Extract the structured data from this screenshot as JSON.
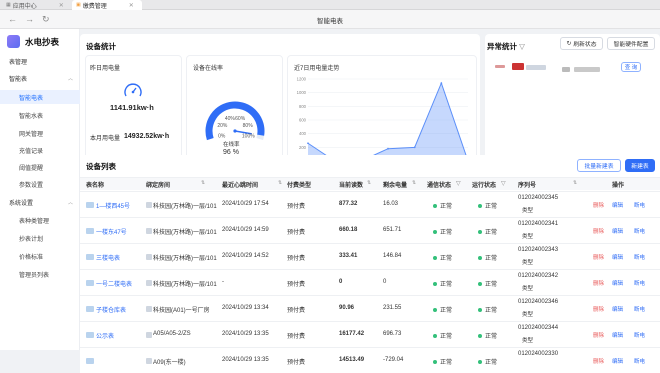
{
  "tabs": [
    {
      "label": "应用中心"
    },
    {
      "label": "缴费管理"
    }
  ],
  "window_title": "智能电表",
  "brand": "水电抄表",
  "sidebar": {
    "items": [
      {
        "label": "表管理",
        "type": "group"
      },
      {
        "label": "智能表",
        "type": "group",
        "active_group": true
      },
      {
        "label": "智能电表",
        "type": "sub",
        "active": true
      },
      {
        "label": "智能水表",
        "type": "sub"
      },
      {
        "label": "网关管理",
        "type": "sub"
      },
      {
        "label": "充值记录",
        "type": "sub"
      },
      {
        "label": "阈值提醒",
        "type": "sub"
      },
      {
        "label": "参数设置",
        "type": "sub"
      },
      {
        "label": "系统设置",
        "type": "group"
      },
      {
        "label": "表种类管理",
        "type": "sub"
      },
      {
        "label": "抄表计划",
        "type": "sub"
      },
      {
        "label": "价格标准",
        "type": "sub"
      },
      {
        "label": "管理员列表",
        "type": "sub"
      }
    ]
  },
  "stats": {
    "title": "设备统计",
    "yesterday": {
      "label": "昨日用电量",
      "value": "1141.91kw·h",
      "month_label": "本月用电量",
      "month_value": "14932.52kw·h"
    },
    "online": {
      "label": "设备在线率",
      "gauge_value": 96,
      "gauge_ticks": [
        "0%",
        "20%",
        "40%",
        "60%",
        "80%",
        "100%"
      ],
      "rate_label": "在线率",
      "rate_value": "96 %"
    },
    "trend": {
      "label": "近7日用电量走势"
    }
  },
  "chart_data": {
    "type": "area",
    "title": "近7日用电量走势",
    "categories": [
      "10月23日",
      "10月24日",
      "10月25日",
      "10月26日",
      "10月27日",
      "10月28日",
      "10月29日"
    ],
    "values": [
      260,
      0,
      0,
      180,
      200,
      1140,
      0
    ],
    "ylim": [
      0,
      1200
    ],
    "yticks": [
      0,
      200,
      400,
      600,
      800,
      1000,
      1200
    ],
    "color": "#5b8ff9"
  },
  "exceptions": {
    "title": "异常统计",
    "refresh": "刷新状态",
    "hardware": "智能硬件配置",
    "query": "查 询"
  },
  "device_list": {
    "title": "设备列表",
    "batch_btn": "批量新建表",
    "new_btn": "新建表",
    "columns": [
      "表名称",
      "绑定房间",
      "最近心跳时间",
      "付费类型",
      "当前读数",
      "剩余电量",
      "通信状态",
      "运行状态",
      "序列号",
      "操作"
    ],
    "rows": [
      {
        "name": "1—楼西45号",
        "room": "科技园(万林路)一层/101",
        "time": "2024/10/29 17:54",
        "pay": "预付费",
        "reading": "877.32",
        "remain": "16.03",
        "comm": "正常",
        "run": "正常",
        "serial": "012024002345",
        "serial_type": "类型",
        "ops": [
          "删除",
          "编辑",
          "断电"
        ]
      },
      {
        "name": "一楼东47号",
        "room": "科技园(万林路)一层/101",
        "time": "2024/10/29 14:59",
        "pay": "预付费",
        "reading": "660.18",
        "remain": "651.71",
        "comm": "正常",
        "run": "正常",
        "serial": "012024002341",
        "serial_type": "类型",
        "ops": [
          "删除",
          "编辑",
          "断电"
        ]
      },
      {
        "name": "三楼电表",
        "room": "科技园(万林路)一层/101",
        "time": "2024/10/29 14:52",
        "pay": "预付费",
        "reading": "333.41",
        "remain": "146.84",
        "comm": "正常",
        "run": "正常",
        "serial": "012024002343",
        "serial_type": "类型",
        "ops": [
          "删除",
          "编辑",
          "断电"
        ]
      },
      {
        "name": "一号二楼电表",
        "room": "科技园(万林路)一层/101",
        "time": "-",
        "pay": "预付费",
        "reading": "0",
        "remain": "0",
        "comm": "正常",
        "run": "正常",
        "serial": "012024002342",
        "serial_type": "类型",
        "ops": [
          "删除",
          "编辑",
          "断电"
        ]
      },
      {
        "name": "子楼仓库表",
        "room": "科技园(A01)一号厂房",
        "time": "2024/10/29 13:34",
        "pay": "预付费",
        "reading": "90.96",
        "remain": "231.55",
        "comm": "正常",
        "run": "正常",
        "serial": "012024002346",
        "serial_type": "类型",
        "ops": [
          "删除",
          "编辑",
          "断电"
        ]
      },
      {
        "name": "公示表",
        "room": "A05/A05-2/ZS",
        "time": "2024/10/29 13:35",
        "pay": "预付费",
        "reading": "16177.42",
        "remain": "696.73",
        "comm": "正常",
        "run": "正常",
        "serial": "012024002344",
        "serial_type": "类型",
        "ops": [
          "删除",
          "编辑",
          "断电"
        ]
      },
      {
        "name": "",
        "room": "A09(东一楼)",
        "time": "2024/10/29 13:35",
        "pay": "预付费",
        "reading": "14513.49",
        "remain": "-729.04",
        "comm": "正常",
        "run": "正常",
        "serial": "012024002330",
        "serial_type": "",
        "ops": [
          "删除",
          "编辑",
          "断电"
        ]
      }
    ]
  }
}
